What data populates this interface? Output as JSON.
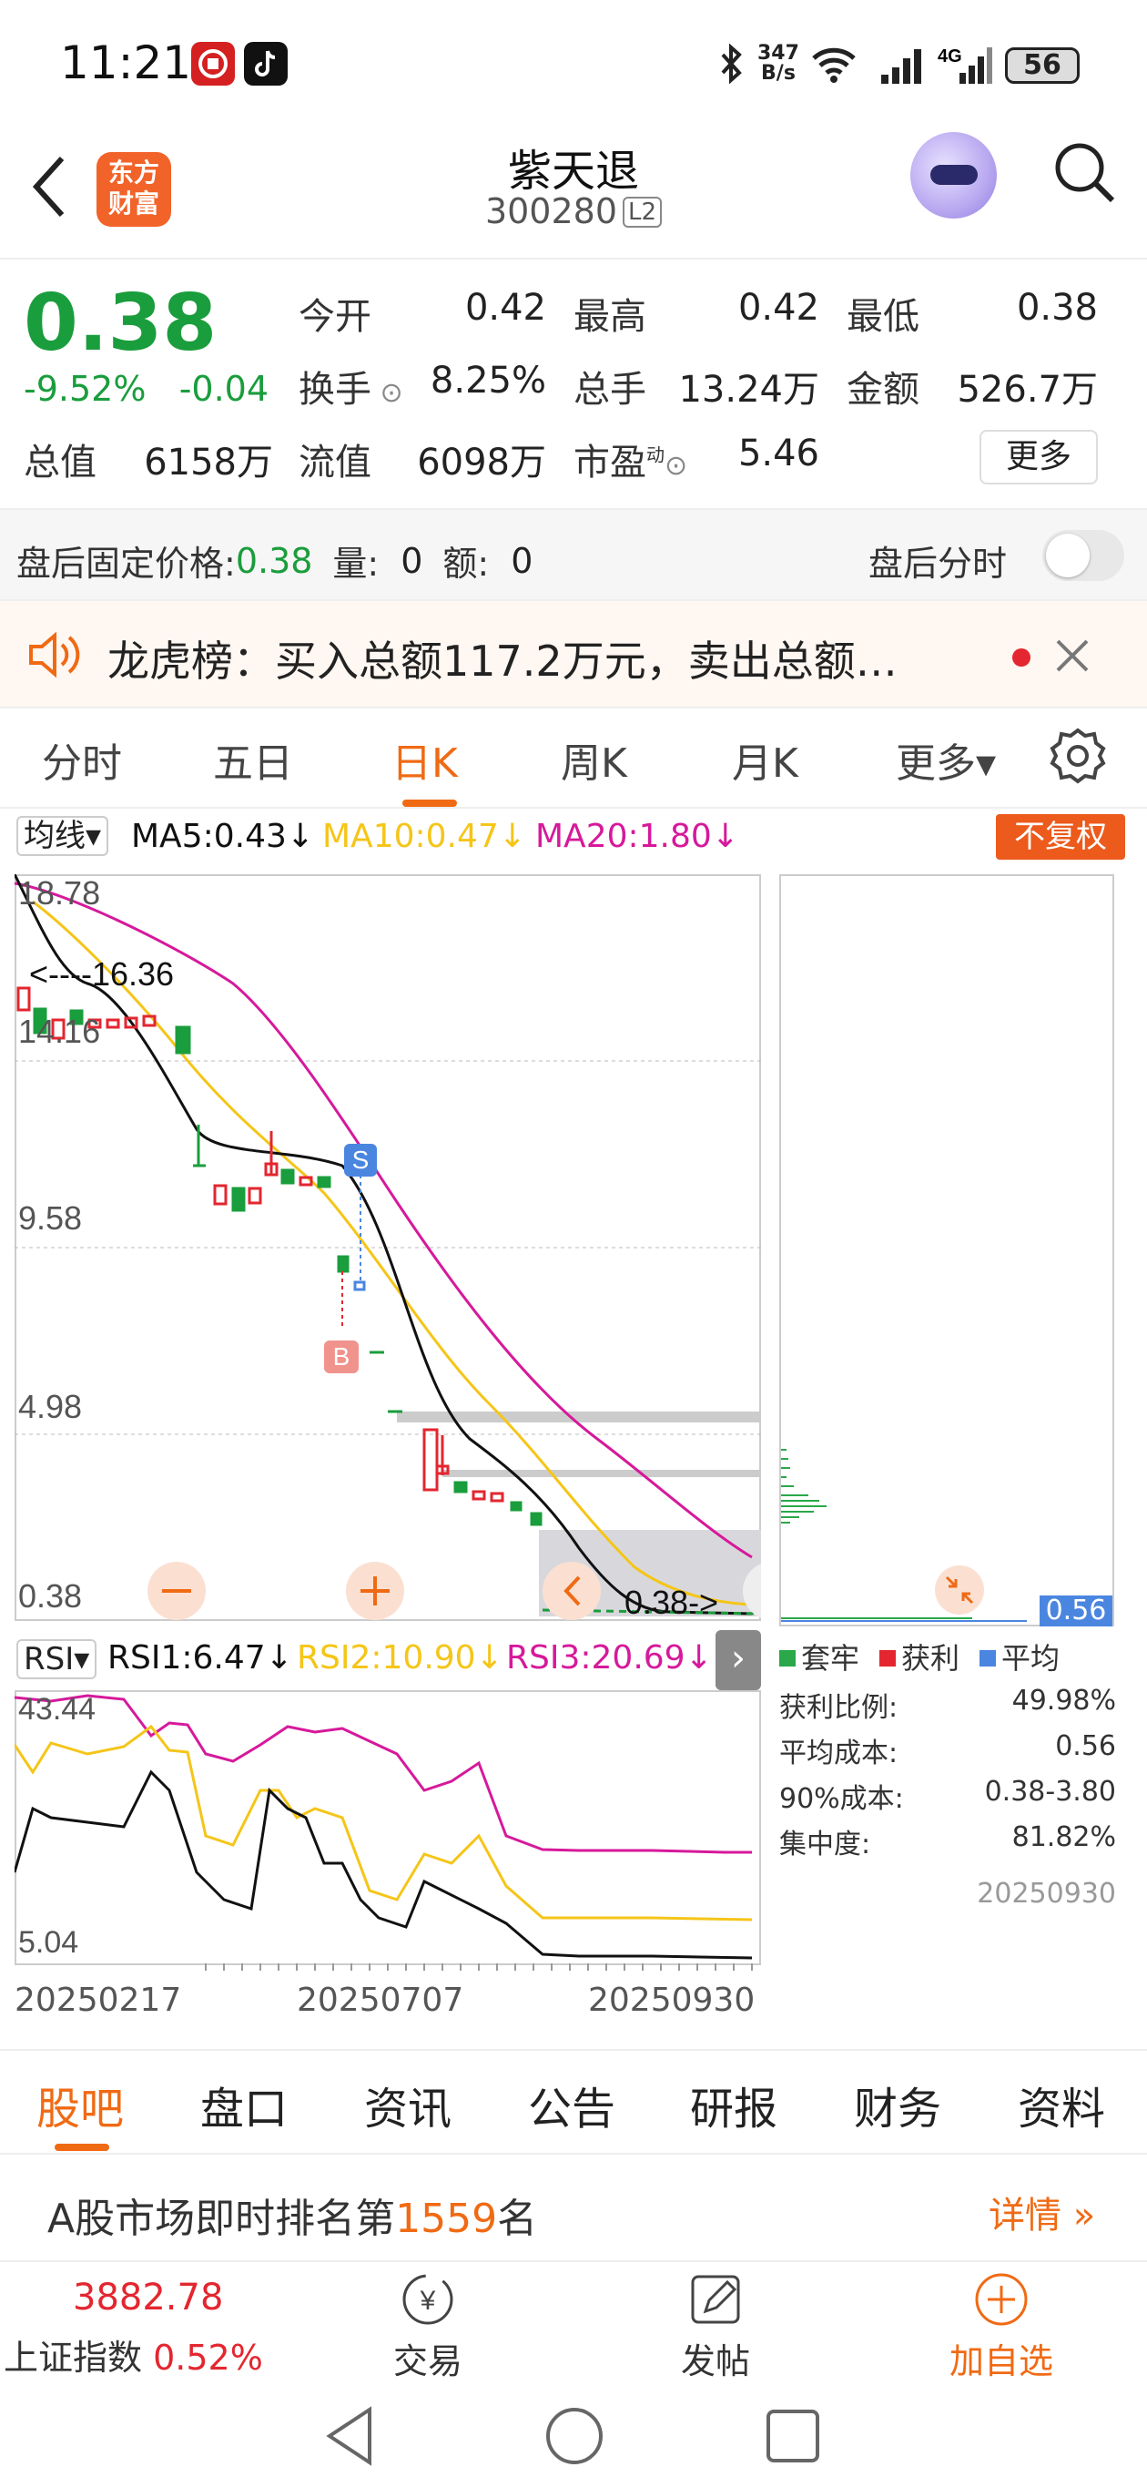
{
  "status_bar": {
    "time": "11:21",
    "net_speed_top": "347",
    "net_speed_bottom": "B/s",
    "battery": "56",
    "network": "4G"
  },
  "header": {
    "name": "紫天退",
    "code": "300280",
    "level": "L2",
    "logo_line1": "东方",
    "logo_line2": "财富"
  },
  "quote": {
    "price": "0.38",
    "change_pct": "-9.52%",
    "change": "-0.04",
    "stats": [
      {
        "k": "今开",
        "v": "0.42"
      },
      {
        "k": "最高",
        "v": "0.42"
      },
      {
        "k": "最低",
        "v": "0.38"
      },
      {
        "k": "换手",
        "v": "8.25%"
      },
      {
        "k": "总手",
        "v": "13.24万"
      },
      {
        "k": "金额",
        "v": "526.7万"
      },
      {
        "k": "总值",
        "v": "6158万"
      },
      {
        "k": "流值",
        "v": "6098万"
      },
      {
        "k": "市盈",
        "v": "5.46"
      }
    ],
    "pe_sup": "动",
    "more": "更多"
  },
  "after_hours": {
    "label": "盘后固定价格:",
    "price": "0.38",
    "vol_label": "量:",
    "vol": "0",
    "amt_label": "额:",
    "amt": "0",
    "toggle_label": "盘后分时"
  },
  "notice": {
    "text": "龙虎榜：买入总额117.2万元，卖出总额…"
  },
  "period_tabs": [
    "分时",
    "五日",
    "日K",
    "周K",
    "月K",
    "更多▾"
  ],
  "ma_bar": {
    "select": "均线▾",
    "ma5": "MA5:0.43↓",
    "ma10": "MA10:0.47↓",
    "ma20": "MA20:1.80↓",
    "adjust": "不复权"
  },
  "chart": {
    "y_labels": [
      "18.78",
      "14.16",
      "9.58",
      "4.98",
      "0.38"
    ],
    "high_marker": "<----16.36",
    "low_marker": "0.38->",
    "buy_mark": "B",
    "sell_mark": "S",
    "chip_price": "0.56"
  },
  "rsi_bar": {
    "select": "RSI▾",
    "rsi1": "RSI1:6.47↓",
    "rsi2": "RSI2:10.90↓",
    "rsi3": "RSI3:20.69↓",
    "y_top": "43.44",
    "y_bottom": "5.04"
  },
  "dates": [
    "20250217",
    "20250707",
    "20250930"
  ],
  "chip_info": {
    "legend": [
      "套牢",
      "获利",
      "平均"
    ],
    "rows": [
      {
        "k": "获利比例:",
        "v": "49.98%"
      },
      {
        "k": "平均成本:",
        "v": "0.56"
      },
      {
        "k": "90%成本:",
        "v": "0.38-3.80"
      },
      {
        "k": "集中度:",
        "v": "81.82%"
      }
    ],
    "date": "20250930"
  },
  "bottom_tabs": [
    "股吧",
    "盘口",
    "资讯",
    "公告",
    "研报",
    "财务",
    "资料"
  ],
  "rank": {
    "prefix": "A股市场即时排名第",
    "num": "1559",
    "suffix": "名",
    "detail": "详情"
  },
  "footer": {
    "index_value": "3882.78",
    "index_name": "上证指数",
    "index_pct": "0.52%",
    "trade": "交易",
    "post": "发帖",
    "watch": "加自选"
  },
  "colors": {
    "up": "#e3262f",
    "down": "#1a9d3c",
    "accent": "#f06a14",
    "ma5": "#111111",
    "ma10": "#f5c518",
    "ma20": "#d6199b"
  }
}
